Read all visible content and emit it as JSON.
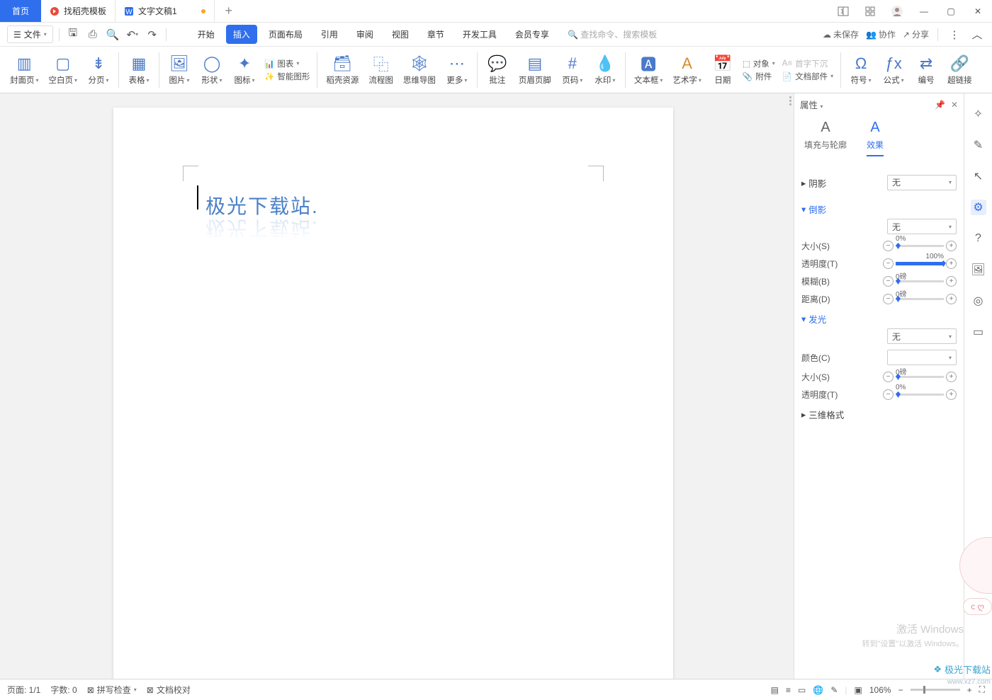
{
  "titlebar": {
    "home": "首页",
    "tab1": "找稻壳模板",
    "tab2": "文字文稿1",
    "plus": "+"
  },
  "winctl": {
    "layout": "⿰",
    "grid": "▦",
    "min": "—",
    "max": "▢",
    "close": "✕"
  },
  "menubar": {
    "file": "文件",
    "tabs": [
      "开始",
      "插入",
      "页面布局",
      "引用",
      "审阅",
      "视图",
      "章节",
      "开发工具",
      "会员专享"
    ],
    "activeTab": 1,
    "search_placeholder": "查找命令、搜索模板",
    "unsaved": "未保存",
    "coop": "协作",
    "share": "分享"
  },
  "ribbon": {
    "cover": "封面页",
    "blank": "空白页",
    "break": "分页",
    "table": "表格",
    "pic": "图片",
    "shape": "形状",
    "icon": "图标",
    "chart": "图表",
    "smart": "智能图形",
    "daoke": "稻壳资源",
    "flow": "流程图",
    "mind": "思维导图",
    "more": "更多",
    "comment": "批注",
    "header": "页眉页脚",
    "pageno": "页码",
    "watermark": "水印",
    "textbox": "文本框",
    "artword": "艺术字",
    "date": "日期",
    "object": "对象",
    "dropcap": "首字下沉",
    "attach": "附件",
    "docpart": "文档部件",
    "symbol": "符号",
    "formula": "公式",
    "numbering": "编号",
    "hyperlink": "超链接"
  },
  "document": {
    "wordart_text": "极光下载站."
  },
  "sidepanel": {
    "title": "属性",
    "tab_fill": "填充与轮廓",
    "tab_effect": "效果",
    "sec_shadow": "阴影",
    "sec_reflect": "倒影",
    "sec_glow": "发光",
    "sec_3d": "三维格式",
    "none": "无",
    "size": "大小(S)",
    "opacity": "透明度(T)",
    "blur": "模糊(B)",
    "distance": "距离(D)",
    "color": "颜色(C)",
    "vals": {
      "size0": "0%",
      "opacity100": "100%",
      "pt0": "0磅",
      "pct0": "0%"
    }
  },
  "statusbar": {
    "page": "页面: 1/1",
    "words": "字数: 0",
    "spell": "拼写检查",
    "proof": "文档校对",
    "zoom": "106%"
  },
  "watermark": {
    "l1": "激活 Windows",
    "l2": "转到\"设置\"以激活 Windows。"
  },
  "brand": {
    "name": "极光下载站",
    "url": "www.xz7.com"
  },
  "mascot": "ᴄ ღ"
}
